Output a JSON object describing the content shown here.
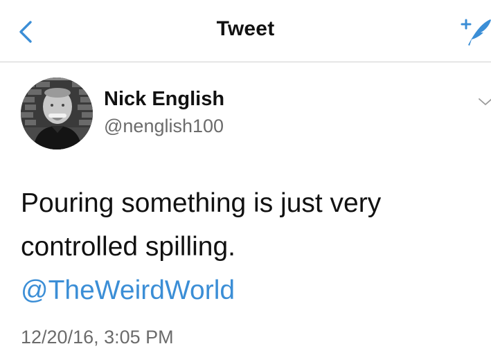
{
  "header": {
    "title": "Tweet",
    "back_icon": "chevron-left-icon",
    "compose_icon": "compose-tweet-icon",
    "accent_color": "#3b8ed6"
  },
  "tweet": {
    "author_name": "Nick English",
    "author_handle": "@nenglish100",
    "avatar_icon": "avatar",
    "menu_icon": "chevron-down-icon",
    "text_line1": "Pouring something is just very",
    "text_line2": "controlled spilling.",
    "mention": "@TheWeirdWorld",
    "timestamp": "12/20/16, 3:05 PM"
  }
}
